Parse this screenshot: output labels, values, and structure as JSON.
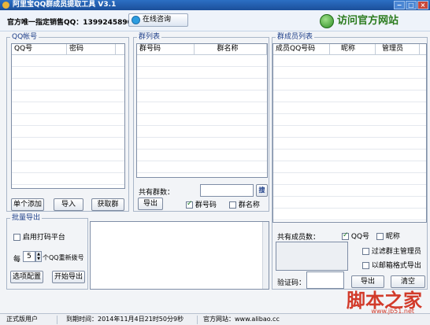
{
  "window": {
    "title": "阿里宝QQ群成员提取工具 V3.1",
    "controls": [
      "−",
      "□",
      "×"
    ]
  },
  "toolbar": {
    "sales_text": "官方唯一指定销售QQ：1399245890",
    "consult_label": "在线咨询",
    "visit_label": "访问官方网站"
  },
  "qq_account": {
    "group_title": "QQ帐号",
    "columns": [
      "QQ号",
      "密码"
    ],
    "buttons": {
      "add_single": "单个添加",
      "import": "导入",
      "get_groups": "获取群"
    }
  },
  "group_list": {
    "group_title": "群列表",
    "columns": [
      "群号码",
      "群名称"
    ],
    "total_label": "共有群数：",
    "search_icon": "搜",
    "export_label": "导出",
    "check_number": "群号码",
    "check_name": "群名称",
    "check_number_checked": true,
    "check_name_checked": false
  },
  "member_list": {
    "group_title": "群成员列表",
    "columns": [
      "成员QQ号码",
      "昵称",
      "管理员"
    ],
    "total_label": "共有成员数：",
    "check_qq": "QQ号",
    "check_nick": "昵称",
    "check_qq_checked": true,
    "check_nick_checked": false,
    "filter_admin": "过滤群主管理员",
    "mailbox_export": "以邮箱格式导出",
    "captcha_label": "验证码：",
    "export_label": "导出",
    "clear_label": "清空"
  },
  "batch_export": {
    "group_title": "批量导出",
    "captcha_platform": "启用打码平台",
    "every_label": "每",
    "every_value": "5",
    "every_suffix": "个QQ重新拨号",
    "options_label": "选项配置",
    "start_label": "开始导出"
  },
  "status": {
    "user_type": "正式版用户",
    "expiry": "到期时间：2014年11月4日21时50分9秒",
    "website": "官方网站：www.alibao.cc"
  },
  "watermark": {
    "text": "脚本之家",
    "url": "www.jb51.net"
  }
}
